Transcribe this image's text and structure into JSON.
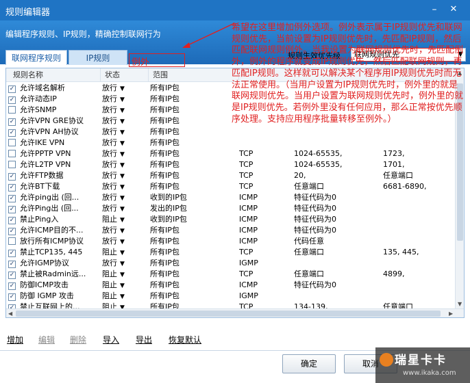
{
  "window": {
    "title": "规则编辑器",
    "min_icon": "minimize-icon",
    "close_icon": "close-icon"
  },
  "header": {
    "description": "编辑程序规则、IP规则，精确控制联网行为"
  },
  "tabs": [
    {
      "label": "联网程序规则"
    },
    {
      "label": "IP规则"
    }
  ],
  "annotation": {
    "label": "例外",
    "text": "希望在这里增加例外选项。例外表示属于IP规则优先和联网规则优先，当前设置为IP规则优先时，先匹配IP规则，然后匹配联网规则例外。当我设置为联网规则优先时，先匹配例外，例外的程序就变成IP规则优先，然后匹配联网规则，再匹配IP规则。这样就可以解决某个程序用IP规则优先时而无法正常使用。（当用户设置为IP规则优先时，例外里的就是联网规则优先。当用户设置为联网规则优先时，例外里的就是IP规则优先。若例外里没有任何应用，那么正常按优先顺序处理。支持应用程序批量转移至例外。）",
    "color": "#e02020"
  },
  "priority": {
    "label": "规则生效优先级",
    "value": "联网规则优先"
  },
  "table": {
    "columns": [
      "规则名称",
      "状态",
      "范围"
    ],
    "rows": [
      {
        "checked": true,
        "name": "允许域名解析",
        "status": "放行",
        "range": "所有IP包",
        "proto": "",
        "port1": "",
        "port2": ""
      },
      {
        "checked": true,
        "name": "允许动态IP",
        "status": "放行",
        "range": "所有IP包",
        "proto": "",
        "port1": "",
        "port2": ""
      },
      {
        "checked": false,
        "name": "允许SNMP",
        "status": "放行",
        "range": "所有IP包",
        "proto": "",
        "port1": "",
        "port2": ""
      },
      {
        "checked": true,
        "name": "允许VPN GRE协议",
        "status": "放行",
        "range": "所有IP包",
        "proto": "",
        "port1": "",
        "port2": ""
      },
      {
        "checked": true,
        "name": "允许VPN AH协议",
        "status": "放行",
        "range": "所有IP包",
        "proto": "",
        "port1": "",
        "port2": ""
      },
      {
        "checked": false,
        "name": "允许IKE VPN",
        "status": "放行",
        "range": "所有IP包",
        "proto": "",
        "port1": "",
        "port2": ""
      },
      {
        "checked": false,
        "name": "允许PPTP VPN",
        "status": "放行",
        "range": "所有IP包",
        "proto": "TCP",
        "port1": "1024-65535,",
        "port2": "1723,"
      },
      {
        "checked": false,
        "name": "允许L2TP VPN",
        "status": "放行",
        "range": "所有IP包",
        "proto": "TCP",
        "port1": "1024-65535,",
        "port2": "1701,"
      },
      {
        "checked": true,
        "name": "允许FTP数据",
        "status": "放行",
        "range": "所有IP包",
        "proto": "TCP",
        "port1": "20,",
        "port2": "任意端口"
      },
      {
        "checked": true,
        "name": "允许BT下载",
        "status": "放行",
        "range": "所有IP包",
        "proto": "TCP",
        "port1": "任意端口",
        "port2": "6681-6890,"
      },
      {
        "checked": true,
        "name": "允许ping出 (回...",
        "status": "放行",
        "range": "收到的IP包",
        "proto": "ICMP",
        "port1": "特征代码为0",
        "port2": ""
      },
      {
        "checked": true,
        "name": "允许Ping出 (回...",
        "status": "放行",
        "range": "发出的IP包",
        "proto": "ICMP",
        "port1": "特征代码为0",
        "port2": ""
      },
      {
        "checked": true,
        "name": "禁止Ping入",
        "status": "阻止",
        "range": "收到的IP包",
        "proto": "ICMP",
        "port1": "特征代码为0",
        "port2": ""
      },
      {
        "checked": true,
        "name": "允许ICMP目的不...",
        "status": "放行",
        "range": "所有IP包",
        "proto": "ICMP",
        "port1": "特征代码为0",
        "port2": ""
      },
      {
        "checked": false,
        "name": "放行所有ICMP协议",
        "status": "放行",
        "range": "所有IP包",
        "proto": "ICMP",
        "port1": "代码任意",
        "port2": ""
      },
      {
        "checked": true,
        "name": "禁止TCP135, 445",
        "status": "阻止",
        "range": "所有IP包",
        "proto": "TCP",
        "port1": "任意端口",
        "port2": "135, 445,"
      },
      {
        "checked": true,
        "name": "允许IGMP协议",
        "status": "放行",
        "range": "所有IP包",
        "proto": "IGMP",
        "port1": "",
        "port2": ""
      },
      {
        "checked": true,
        "name": "禁止被Radmin远...",
        "status": "阻止",
        "range": "所有IP包",
        "proto": "TCP",
        "port1": "任意端口",
        "port2": "4899,"
      },
      {
        "checked": true,
        "name": "防御ICMP攻击",
        "status": "阻止",
        "range": "所有IP包",
        "proto": "ICMP",
        "port1": "特征代码为0",
        "port2": ""
      },
      {
        "checked": true,
        "name": "防御 IGMP 攻击",
        "status": "阻止",
        "range": "所有IP包",
        "proto": "IGMP",
        "port1": "",
        "port2": ""
      },
      {
        "checked": true,
        "name": "禁止互联网上的...",
        "status": "阻止",
        "range": "所有IP包",
        "proto": "TCP",
        "port1": "134-139,",
        "port2": "任意端口"
      }
    ]
  },
  "actions": [
    {
      "label": "增加",
      "enabled": true
    },
    {
      "label": "编辑",
      "enabled": false
    },
    {
      "label": "删除",
      "enabled": false
    },
    {
      "label": "导入",
      "enabled": true
    },
    {
      "label": "导出",
      "enabled": true
    },
    {
      "label": "恢复默认",
      "enabled": true
    }
  ],
  "buttons": {
    "ok": "确定",
    "cancel": "取消"
  },
  "watermark": {
    "brand": "瑞星卡卡",
    "url": "www.ikaka.com"
  },
  "colors": {
    "titlebar": "#1f74c4",
    "header": "#2f8ad8",
    "accent": "#1a5ea8"
  }
}
